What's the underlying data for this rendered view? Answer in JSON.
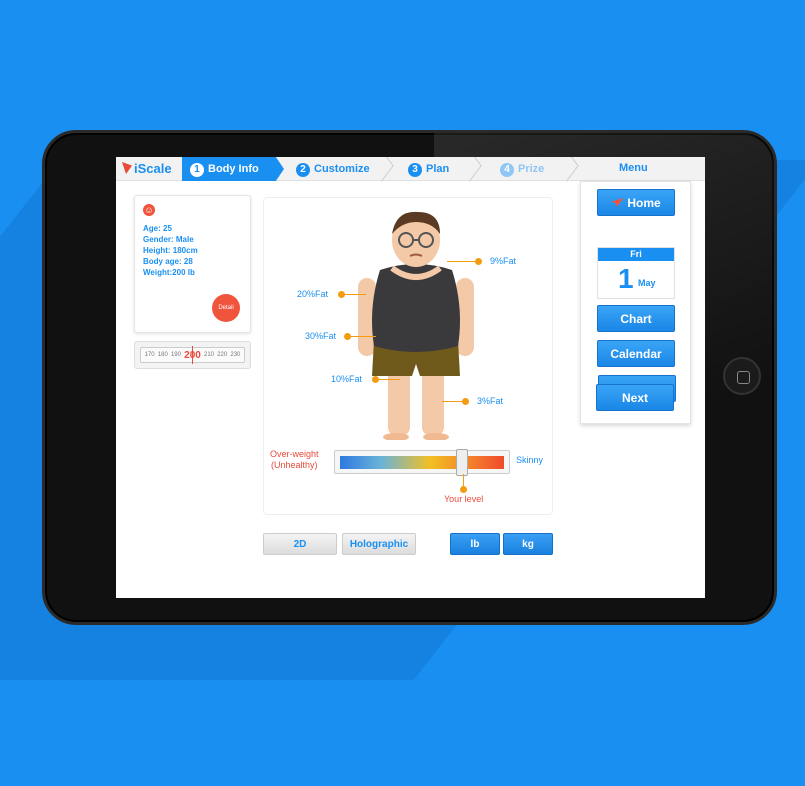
{
  "app": {
    "logo_text": "iScale"
  },
  "nav": {
    "steps": [
      {
        "num": "1",
        "label": "Body Info"
      },
      {
        "num": "2",
        "label": "Customize"
      },
      {
        "num": "3",
        "label": "Plan"
      },
      {
        "num": "4",
        "label": "Prize"
      }
    ],
    "menu_label": "Menu"
  },
  "profile": {
    "age": "Age: 25",
    "gender": "Gender: Male",
    "height": "Height: 180cm",
    "body_age": "Body age: 28",
    "weight": "Weight:200 lb",
    "detail_button": "Detail"
  },
  "ruler": {
    "ticks": [
      "170",
      "180",
      "190",
      "200",
      "210",
      "220",
      "230"
    ],
    "current": "200"
  },
  "body_callouts": {
    "c1": "9%Fat",
    "c2": "20%Fat",
    "c3": "30%Fat",
    "c4": "10%Fat",
    "c5": "3%Fat"
  },
  "scale": {
    "left_label_1": "Over-weight",
    "left_label_2": "(Unhealthy)",
    "right_label": "Skinny",
    "level_label": "Your level",
    "level_fraction": 0.75
  },
  "view_toggle": {
    "option_2d": "2D",
    "option_holo": "Holographic"
  },
  "unit_toggle": {
    "lb": "lb",
    "kg": "kg"
  },
  "menu": {
    "home": "Home",
    "calendar": {
      "weekday": "Fri",
      "day": "1",
      "month": "May"
    },
    "chart": "Chart",
    "calendar_btn": "Calendar",
    "back": "Back",
    "next": "Next"
  },
  "colors": {
    "accent": "#1a8ff2",
    "alert": "#f0543c",
    "callout": "#f39c12"
  }
}
